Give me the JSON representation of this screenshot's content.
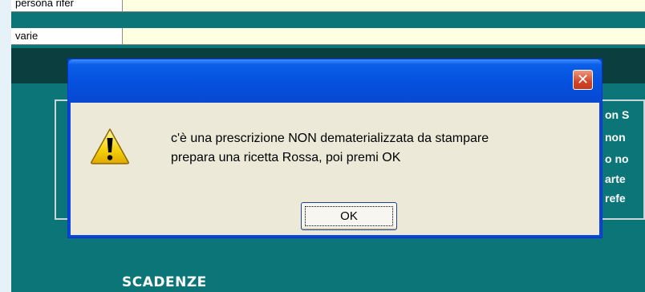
{
  "form": {
    "rows": [
      {
        "label": "persona rifer"
      },
      {
        "label": "varie"
      }
    ]
  },
  "side_labels": [
    "on S",
    "non",
    "o no",
    "arte",
    "refe"
  ],
  "section_title": "SCADENZE",
  "dialog": {
    "message_line1": "c'è una prescrizione NON dematerializzata da stampare",
    "message_line2": "prepara una ricetta Rossa, poi premi OK",
    "ok_label": "OK",
    "close_symbol": "✕",
    "icon": "warning-icon"
  },
  "colors": {
    "app_background": "#0b7577",
    "form_field": "#ffffe1",
    "titlebar": "#0550de",
    "dialog_face": "#ece9d8",
    "close_button": "#d1452a"
  }
}
